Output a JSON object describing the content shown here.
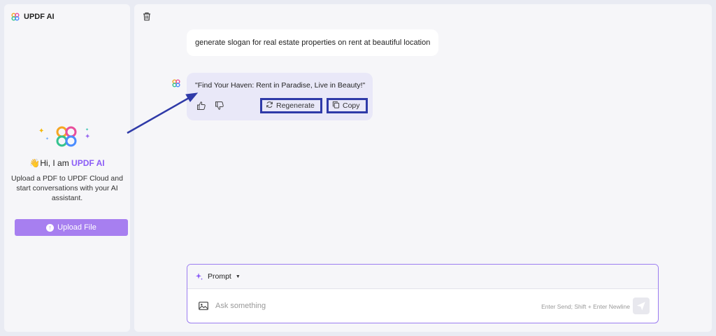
{
  "app": {
    "title": "UPDF AI",
    "brand_colors": {
      "accent": "#8b5cf6",
      "button": "#a77ff0",
      "highlight_box": "#2f3aa8"
    }
  },
  "sidebar": {
    "greeting_prefix": "Hi, I am ",
    "greeting_brand": "UPDF AI",
    "greeting_emoji": "wave-emoji",
    "description": "Upload a PDF to UPDF Cloud and start conversations with your AI assistant.",
    "upload_button": "Upload File"
  },
  "chat": {
    "user_message": "generate slogan for real estate properties on rent at beautiful location",
    "ai_message": "\"Find Your Haven: Rent in Paradise, Live in Beauty!\"",
    "actions": {
      "regenerate": "Regenerate",
      "copy": "Copy"
    },
    "icons": [
      "trash-icon",
      "thumbs-up-icon",
      "thumbs-down-icon",
      "regenerate-icon",
      "copy-icon"
    ]
  },
  "composer": {
    "mode_label": "Prompt",
    "placeholder": "Ask something",
    "hint": "Enter Send; Shift + Enter Newline"
  }
}
